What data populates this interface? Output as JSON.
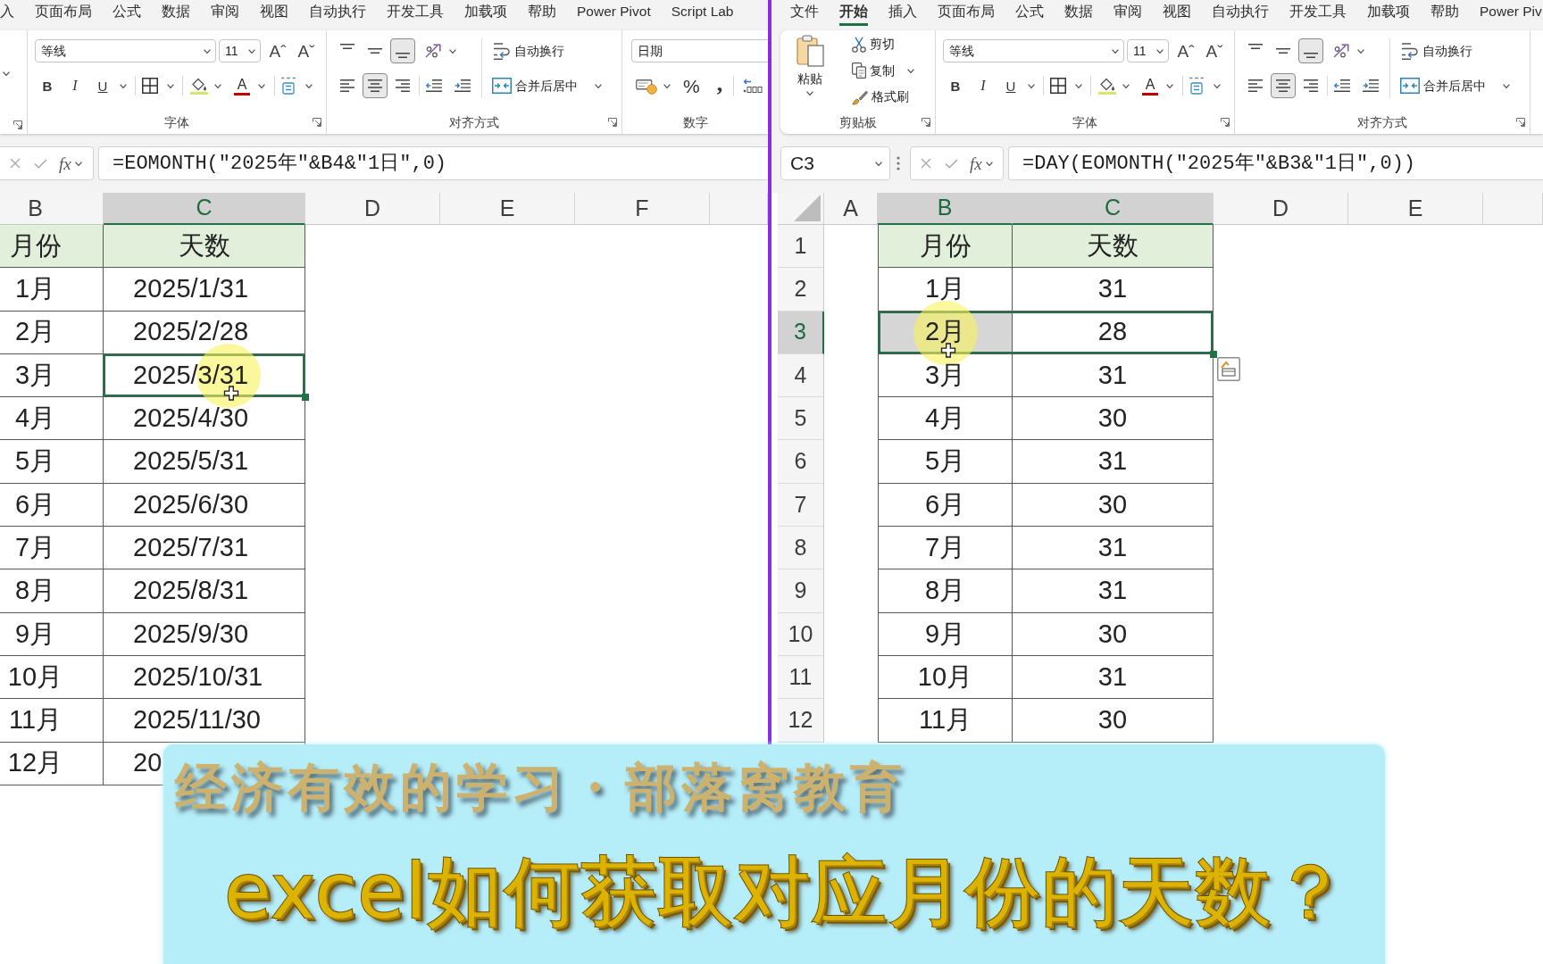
{
  "left_pane": {
    "ribbon_tabs": [
      {
        "label": "入",
        "selected": false
      },
      {
        "label": "页面布局",
        "selected": false
      },
      {
        "label": "公式",
        "selected": false
      },
      {
        "label": "数据",
        "selected": false
      },
      {
        "label": "审阅",
        "selected": false
      },
      {
        "label": "视图",
        "selected": false
      },
      {
        "label": "自动执行",
        "selected": false
      },
      {
        "label": "开发工具",
        "selected": false
      },
      {
        "label": "加载项",
        "selected": false
      },
      {
        "label": "帮助",
        "selected": false
      },
      {
        "label": "Power Pivot",
        "selected": false
      },
      {
        "label": "Script Lab",
        "selected": false
      }
    ],
    "ribbon_groups": [
      {
        "kind": "cut_off"
      },
      {
        "kind": "font",
        "label": "字体",
        "font_name": "等线",
        "font_size": "11",
        "grow_font": "Aˆ",
        "shrink_font": "Aˇ",
        "bold": "B",
        "italic": "I",
        "underline": "U",
        "font_color": "A"
      },
      {
        "kind": "alignment",
        "label": "对齐方式",
        "vertical_align": [
          {
            "selected": false
          },
          {
            "selected": false
          },
          {
            "selected": true
          }
        ],
        "horizontal_align": [
          {
            "selected": false
          },
          {
            "selected": true
          },
          {
            "selected": false
          }
        ],
        "wrap_text": "自动换行",
        "merge_center": "合并后居中"
      },
      {
        "kind": "number",
        "label": "数字",
        "number_format": "日期",
        "percent": "%",
        "comma": ","
      }
    ],
    "formula_bar": {
      "fx": "fx",
      "formula": "=EOMONTH(\"2025年\"&B4&\"1日\",0)"
    },
    "grid": {
      "columns": [
        {
          "label": "B",
          "selected": false
        },
        {
          "label": "C",
          "selected": true
        },
        {
          "label": "D",
          "selected": false
        },
        {
          "label": "E",
          "selected": false
        },
        {
          "label": "F",
          "selected": false
        }
      ],
      "rows": [
        {
          "kind": "header",
          "cells": [
            {
              "text": "月份",
              "selected": false,
              "shaded": false,
              "pointer": false
            },
            {
              "text": "天数",
              "selected": false,
              "shaded": false,
              "pointer": false
            }
          ]
        },
        {
          "kind": "data",
          "cells": [
            {
              "text": "1月",
              "selected": false,
              "shaded": false,
              "pointer": false
            },
            {
              "text": "2025/1/31",
              "selected": false,
              "shaded": false,
              "pointer": false
            }
          ]
        },
        {
          "kind": "data",
          "cells": [
            {
              "text": "2月",
              "selected": false,
              "shaded": false,
              "pointer": false
            },
            {
              "text": "2025/2/28",
              "selected": false,
              "shaded": false,
              "pointer": false
            }
          ]
        },
        {
          "kind": "data",
          "cells": [
            {
              "text": "3月",
              "selected": false,
              "shaded": false,
              "pointer": false
            },
            {
              "text": "2025/3/31",
              "selected": true,
              "shaded": false,
              "pointer": true
            }
          ]
        },
        {
          "kind": "data",
          "cells": [
            {
              "text": "4月",
              "selected": false,
              "shaded": false,
              "pointer": false
            },
            {
              "text": "2025/4/30",
              "selected": false,
              "shaded": false,
              "pointer": false
            }
          ]
        },
        {
          "kind": "data",
          "cells": [
            {
              "text": "5月",
              "selected": false,
              "shaded": false,
              "pointer": false
            },
            {
              "text": "2025/5/31",
              "selected": false,
              "shaded": false,
              "pointer": false
            }
          ]
        },
        {
          "kind": "data",
          "cells": [
            {
              "text": "6月",
              "selected": false,
              "shaded": false,
              "pointer": false
            },
            {
              "text": "2025/6/30",
              "selected": false,
              "shaded": false,
              "pointer": false
            }
          ]
        },
        {
          "kind": "data",
          "cells": [
            {
              "text": "7月",
              "selected": false,
              "shaded": false,
              "pointer": false
            },
            {
              "text": "2025/7/31",
              "selected": false,
              "shaded": false,
              "pointer": false
            }
          ]
        },
        {
          "kind": "data",
          "cells": [
            {
              "text": "8月",
              "selected": false,
              "shaded": false,
              "pointer": false
            },
            {
              "text": "2025/8/31",
              "selected": false,
              "shaded": false,
              "pointer": false
            }
          ]
        },
        {
          "kind": "data",
          "cells": [
            {
              "text": "9月",
              "selected": false,
              "shaded": false,
              "pointer": false
            },
            {
              "text": "2025/9/30",
              "selected": false,
              "shaded": false,
              "pointer": false
            }
          ]
        },
        {
          "kind": "data",
          "cells": [
            {
              "text": "10月",
              "selected": false,
              "shaded": false,
              "pointer": false
            },
            {
              "text": "2025/10/31",
              "selected": false,
              "shaded": false,
              "pointer": false
            }
          ]
        },
        {
          "kind": "data",
          "cells": [
            {
              "text": "11月",
              "selected": false,
              "shaded": false,
              "pointer": false
            },
            {
              "text": "2025/11/30",
              "selected": false,
              "shaded": false,
              "pointer": false
            }
          ]
        },
        {
          "kind": "data",
          "cells": [
            {
              "text": "12月",
              "selected": false,
              "shaded": false,
              "pointer": false
            },
            {
              "text": "20",
              "selected": false,
              "shaded": false,
              "pointer": false
            }
          ]
        }
      ]
    }
  },
  "right_pane": {
    "ribbon_tabs": [
      {
        "label": "文件",
        "selected": false
      },
      {
        "label": "开始",
        "selected": true
      },
      {
        "label": "插入",
        "selected": false
      },
      {
        "label": "页面布局",
        "selected": false
      },
      {
        "label": "公式",
        "selected": false
      },
      {
        "label": "数据",
        "selected": false
      },
      {
        "label": "审阅",
        "selected": false
      },
      {
        "label": "视图",
        "selected": false
      },
      {
        "label": "自动执行",
        "selected": false
      },
      {
        "label": "开发工具",
        "selected": false
      },
      {
        "label": "加载项",
        "selected": false
      },
      {
        "label": "帮助",
        "selected": false
      },
      {
        "label": "Power Piv",
        "selected": false
      }
    ],
    "ribbon_groups": [
      {
        "kind": "clipboard",
        "label": "剪贴板",
        "paste": "粘贴",
        "cut": "剪切",
        "copy": "复制",
        "format_painter": "格式刷"
      },
      {
        "kind": "font",
        "label": "字体",
        "font_name": "等线",
        "font_size": "11",
        "grow_font": "Aˆ",
        "shrink_font": "Aˇ",
        "bold": "B",
        "italic": "I",
        "underline": "U",
        "font_color": "A"
      },
      {
        "kind": "alignment",
        "label": "对齐方式",
        "vertical_align": [
          {
            "selected": false
          },
          {
            "selected": false
          },
          {
            "selected": true
          }
        ],
        "horizontal_align": [
          {
            "selected": false
          },
          {
            "selected": true
          },
          {
            "selected": false
          }
        ],
        "wrap_text": "自动换行",
        "merge_center": "合并后居中"
      }
    ],
    "formula_bar": {
      "name_box": "C3",
      "fx": "fx",
      "formula": "=DAY(EOMONTH(\"2025年\"&B3&\"1日\",0))"
    },
    "quick_analysis": true,
    "grid": {
      "columns": [
        {
          "label": "A",
          "selected": false
        },
        {
          "label": "B",
          "selected": true
        },
        {
          "label": "C",
          "selected": true
        },
        {
          "label": "D",
          "selected": false
        },
        {
          "label": "E",
          "selected": false
        }
      ],
      "rows": [
        {
          "number": "1",
          "selected": false,
          "kind": "header",
          "cells": [
            null,
            {
              "text": "月份",
              "selected": false,
              "shaded": false,
              "pointer": false
            },
            {
              "text": "天数",
              "selected": false,
              "shaded": false,
              "pointer": false
            }
          ]
        },
        {
          "number": "2",
          "selected": false,
          "kind": "data",
          "cells": [
            null,
            {
              "text": "1月",
              "selected": false,
              "shaded": false,
              "pointer": false
            },
            {
              "text": "31",
              "selected": false,
              "shaded": false,
              "pointer": false
            }
          ]
        },
        {
          "number": "3",
          "selected": true,
          "kind": "data",
          "cells": [
            null,
            {
              "text": "2月",
              "selected": true,
              "shaded": true,
              "pointer": true
            },
            {
              "text": "28",
              "selected": true,
              "shaded": false,
              "pointer": false
            }
          ]
        },
        {
          "number": "4",
          "selected": false,
          "kind": "data",
          "cells": [
            null,
            {
              "text": "3月",
              "selected": false,
              "shaded": false,
              "pointer": false
            },
            {
              "text": "31",
              "selected": false,
              "shaded": false,
              "pointer": false
            }
          ]
        },
        {
          "number": "5",
          "selected": false,
          "kind": "data",
          "cells": [
            null,
            {
              "text": "4月",
              "selected": false,
              "shaded": false,
              "pointer": false
            },
            {
              "text": "30",
              "selected": false,
              "shaded": false,
              "pointer": false
            }
          ]
        },
        {
          "number": "6",
          "selected": false,
          "kind": "data",
          "cells": [
            null,
            {
              "text": "5月",
              "selected": false,
              "shaded": false,
              "pointer": false
            },
            {
              "text": "31",
              "selected": false,
              "shaded": false,
              "pointer": false
            }
          ]
        },
        {
          "number": "7",
          "selected": false,
          "kind": "data",
          "cells": [
            null,
            {
              "text": "6月",
              "selected": false,
              "shaded": false,
              "pointer": false
            },
            {
              "text": "30",
              "selected": false,
              "shaded": false,
              "pointer": false
            }
          ]
        },
        {
          "number": "8",
          "selected": false,
          "kind": "data",
          "cells": [
            null,
            {
              "text": "7月",
              "selected": false,
              "shaded": false,
              "pointer": false
            },
            {
              "text": "31",
              "selected": false,
              "shaded": false,
              "pointer": false
            }
          ]
        },
        {
          "number": "9",
          "selected": false,
          "kind": "data",
          "cells": [
            null,
            {
              "text": "8月",
              "selected": false,
              "shaded": false,
              "pointer": false
            },
            {
              "text": "31",
              "selected": false,
              "shaded": false,
              "pointer": false
            }
          ]
        },
        {
          "number": "10",
          "selected": false,
          "kind": "data",
          "cells": [
            null,
            {
              "text": "9月",
              "selected": false,
              "shaded": false,
              "pointer": false
            },
            {
              "text": "30",
              "selected": false,
              "shaded": false,
              "pointer": false
            }
          ]
        },
        {
          "number": "11",
          "selected": false,
          "kind": "data",
          "cells": [
            null,
            {
              "text": "10月",
              "selected": false,
              "shaded": false,
              "pointer": false
            },
            {
              "text": "31",
              "selected": false,
              "shaded": false,
              "pointer": false
            }
          ]
        },
        {
          "number": "12",
          "selected": false,
          "kind": "data",
          "cells": [
            null,
            {
              "text": "11月",
              "selected": false,
              "shaded": false,
              "pointer": false
            },
            {
              "text": "30",
              "selected": false,
              "shaded": false,
              "pointer": false
            }
          ]
        }
      ]
    }
  },
  "caption": {
    "slogan": "经济有效的学习・部落窝教育",
    "title": "excel如何获取对应月份的天数？"
  }
}
